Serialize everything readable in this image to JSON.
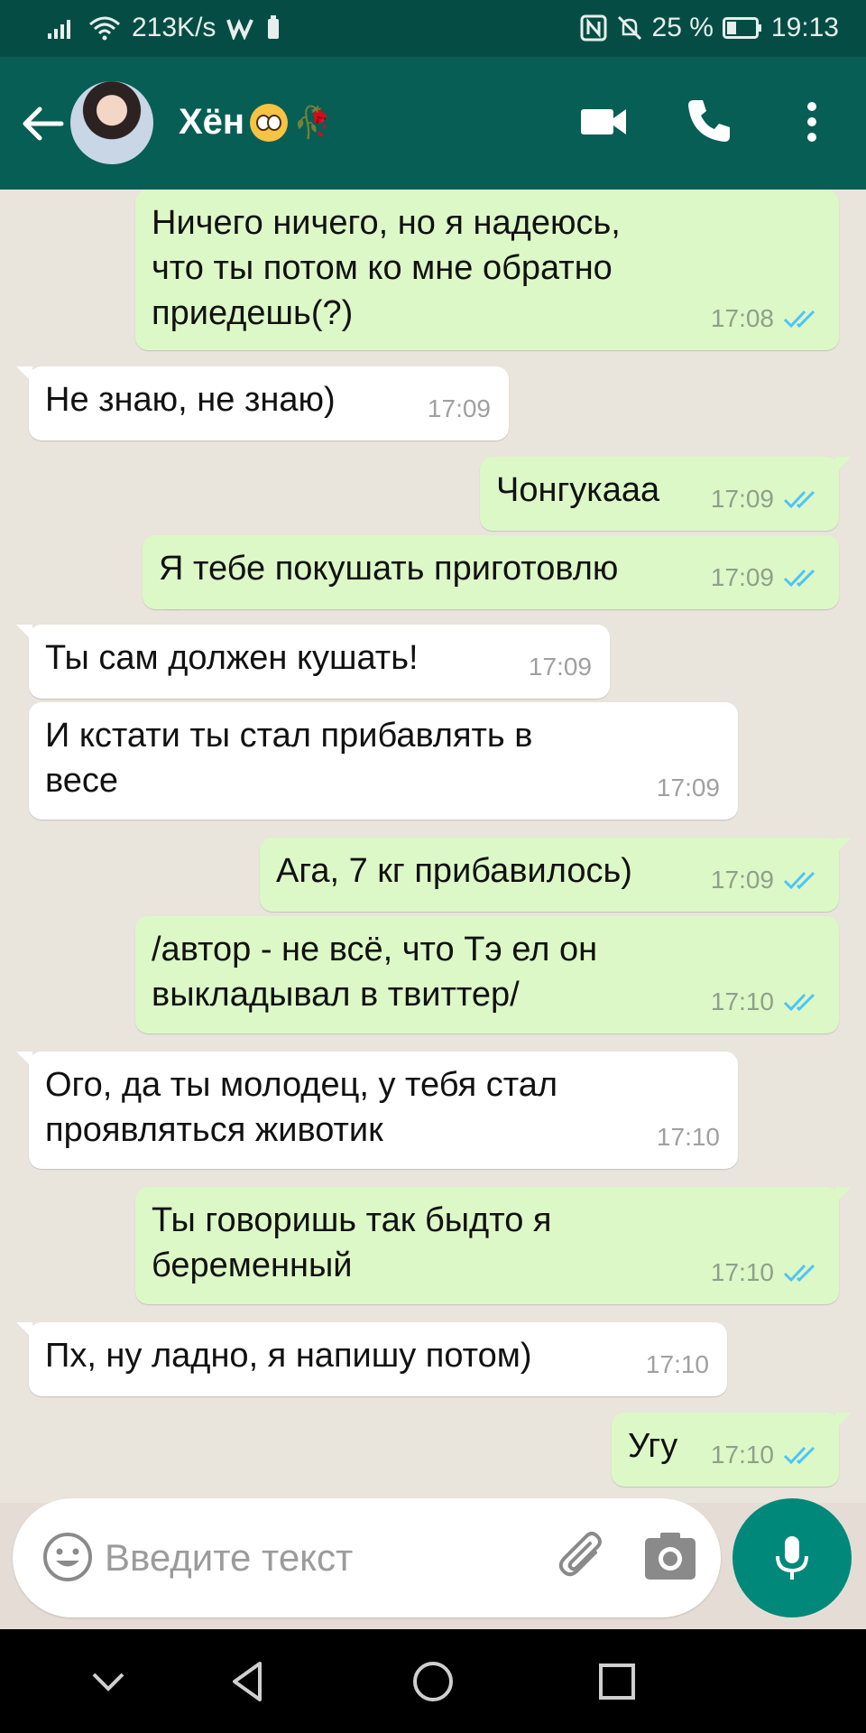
{
  "status_bar": {
    "net_speed": "213K/s",
    "battery": "25 %",
    "time": "19:13"
  },
  "header": {
    "contact_name": "Хён",
    "icons": [
      "back-arrow-icon",
      "video-call-icon",
      "phone-icon",
      "more-vert-icon"
    ]
  },
  "messages": [
    {
      "dir": "out",
      "text": "Ничего ничего, но я надеюсь,\nчто ты потом ко мне обратно\nприедешь(?)",
      "time": "17:08",
      "read": true
    },
    {
      "dir": "in",
      "text": "Не знаю, не знаю)",
      "time": "17:09"
    },
    {
      "dir": "out",
      "text": "Чонгукааа",
      "time": "17:09",
      "read": true
    },
    {
      "dir": "out",
      "text": "Я тебе покушать приготовлю",
      "time": "17:09",
      "read": true
    },
    {
      "dir": "in",
      "text": "Ты сам должен кушать!",
      "time": "17:09"
    },
    {
      "dir": "in",
      "text": "И кстати ты стал прибавлять в\nвесе",
      "time": "17:09"
    },
    {
      "dir": "out",
      "text": "Ага, 7 кг прибавилось)",
      "time": "17:09",
      "read": true
    },
    {
      "dir": "out",
      "text": "/автор - не всё, что Тэ ел он\nвыкладывал в твиттер/",
      "time": "17:10",
      "read": true
    },
    {
      "dir": "in",
      "text": "Ого, да ты молодец, у тебя стал\nпроявляться животик",
      "time": "17:10"
    },
    {
      "dir": "out",
      "text": "Ты говоришь так быдто я\nбеременный",
      "time": "17:10",
      "read": true
    },
    {
      "dir": "in",
      "text": "Пх, ну ладно, я напишу потом)",
      "time": "17:10"
    },
    {
      "dir": "out",
      "text": "Угу",
      "time": "17:10",
      "read": true
    }
  ],
  "input": {
    "placeholder": "Введите текст"
  },
  "colors": {
    "header": "#075e54",
    "status_bar": "#054d44",
    "outgoing_bubble": "#dcf8c6",
    "incoming_bubble": "#ffffff",
    "read_ticks": "#4fc3f7",
    "mic_button": "#00897b"
  }
}
